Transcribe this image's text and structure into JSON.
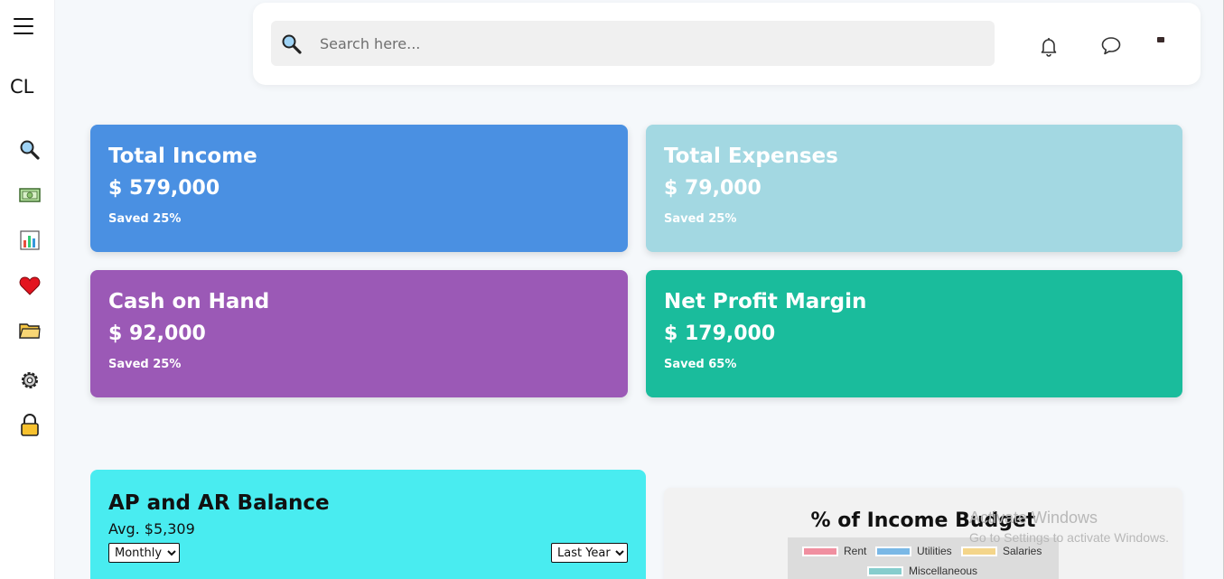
{
  "sidebar": {
    "brand": "CL",
    "items": [
      {
        "icon": "magnifier-icon"
      },
      {
        "icon": "money-icon"
      },
      {
        "icon": "bar-chart-icon"
      },
      {
        "icon": "heart-icon"
      },
      {
        "icon": "folder-icon"
      },
      {
        "icon": "gear-icon"
      },
      {
        "icon": "lock-icon"
      }
    ]
  },
  "header": {
    "search_placeholder": "Search here...",
    "search_value": ""
  },
  "cards": [
    {
      "title": "Total Income",
      "value": "$ 579,000",
      "note": "Saved 25%",
      "color": "#4a90e2"
    },
    {
      "title": "Total Expenses",
      "value": "$ 79,000",
      "note": "Saved 25%",
      "color": "#a3d8e2"
    },
    {
      "title": "Cash on Hand",
      "value": "$ 92,000",
      "note": "Saved 25%",
      "color": "#9b59b6"
    },
    {
      "title": "Net Profit Margin",
      "value": "$ 179,000",
      "note": "Saved 65%",
      "color": "#1abc9c"
    }
  ],
  "ap_panel": {
    "title": "AP and AR Balance",
    "avg": "Avg. $5,309",
    "period_select": "Monthly",
    "range_select": "Last Year",
    "color": "#49ecf0"
  },
  "budget_panel": {
    "title": "% of Income Budget",
    "legend": [
      {
        "label": "Rent",
        "color": "#f08fa0"
      },
      {
        "label": "Utilities",
        "color": "#7ab8e6"
      },
      {
        "label": "Salaries",
        "color": "#f4d58a"
      },
      {
        "label": "Miscellaneous",
        "color": "#86cdcd"
      }
    ]
  },
  "watermark": {
    "line1": "Activate Windows",
    "line2": "Go to Settings to activate Windows."
  }
}
